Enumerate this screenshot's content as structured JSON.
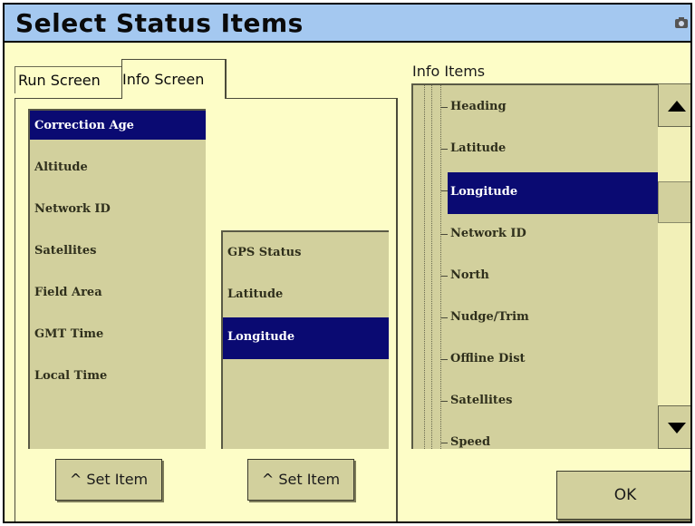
{
  "window": {
    "title": "Select Status Items",
    "icon": "camera-icon"
  },
  "tabs": [
    {
      "label": "Run Screen",
      "active": false
    },
    {
      "label": "Info Screen",
      "active": true
    }
  ],
  "available_list": {
    "items": [
      "Correction Age",
      "Altitude",
      "Network ID",
      "Satellites",
      "Field Area",
      "GMT Time",
      "Local Time"
    ],
    "selected": "Correction Age"
  },
  "assigned_list": {
    "items": [
      "GPS Status",
      "Latitude",
      "Longitude"
    ],
    "selected": "Longitude"
  },
  "buttons": {
    "set_item_1": "^ Set Item",
    "set_item_2": "^ Set Item",
    "ok": "OK"
  },
  "info_items": {
    "label": "Info Items",
    "items": [
      "Heading",
      "Latitude",
      "Longitude",
      "Network ID",
      "North",
      "Nudge/Trim",
      "Offline Dist",
      "Satellites",
      "Speed"
    ],
    "selected": "Longitude"
  },
  "colors": {
    "background": "#fdfdc7",
    "titlebar": "#a4c8f0",
    "selection": "#0a0a72",
    "list_bg": "#d2d09d"
  }
}
